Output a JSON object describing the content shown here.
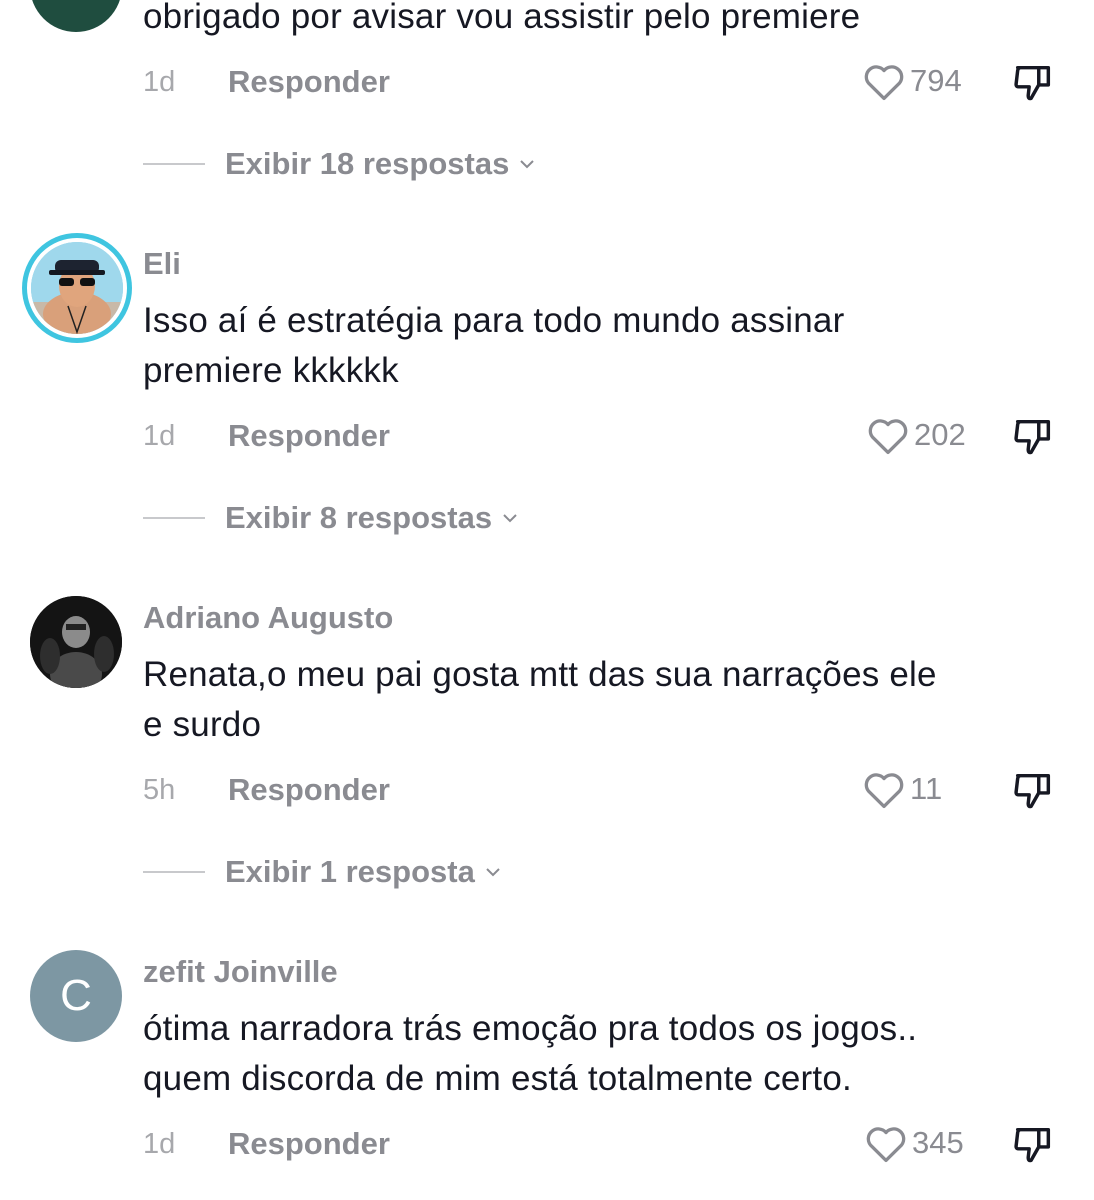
{
  "comments": [
    {
      "username": "",
      "text_lines": [
        "obrigado por avisar vou assistir pelo premiere"
      ],
      "time": "1d",
      "reply_label": "Responder",
      "likes": "794",
      "view_replies": "Exibir 18 respostas",
      "avatar_letter": ""
    },
    {
      "username": "Eli",
      "text_lines": [
        "Isso aí é estratégia para todo mundo assinar",
        "premiere kkkkkk"
      ],
      "time": "1d",
      "reply_label": "Responder",
      "likes": "202",
      "view_replies": "Exibir 8 respostas",
      "avatar_letter": ""
    },
    {
      "username": "Adriano Augusto",
      "text_lines": [
        "Renata,o meu pai gosta mtt das sua narrações ele",
        "e surdo"
      ],
      "time": "5h",
      "reply_label": "Responder",
      "likes": "11",
      "view_replies": "Exibir 1 resposta",
      "avatar_letter": ""
    },
    {
      "username": "zefit Joinville",
      "text_lines": [
        "ótima narradora trás emoção pra todos os jogos..",
        "quem discorda de mim está totalmente certo."
      ],
      "time": "1d",
      "reply_label": "Responder",
      "likes": "345",
      "view_replies": "",
      "avatar_letter": "C"
    }
  ],
  "colors": {
    "text": "#161823",
    "muted": "#8a8b91",
    "avatar_ring": "#3fc5e0",
    "avatar_letter_bg": "#7d97a3"
  },
  "icons": {
    "like": "heart-outline-icon",
    "dislike": "thumbs-down-icon",
    "expand": "chevron-down-icon"
  }
}
